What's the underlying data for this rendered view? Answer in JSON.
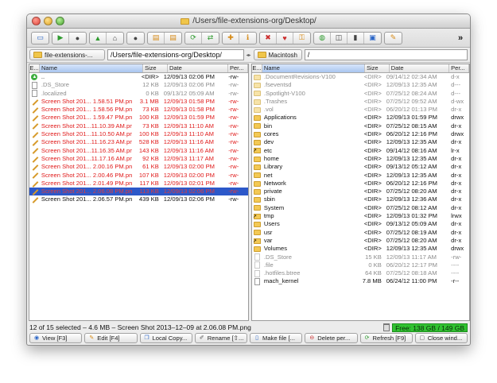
{
  "window": {
    "title": "/Users/file-extensions-org/Desktop/"
  },
  "toolbar": {
    "more_label": "»",
    "buttons": [
      [
        "monitor-icon"
      ],
      [
        "play-icon",
        "stop-icon"
      ],
      [
        "up-icon",
        "home-icon"
      ],
      [
        "record-icon"
      ],
      [
        "copy-folder-icon",
        "move-folder-icon"
      ],
      [
        "refresh-icon",
        "swap-icon"
      ],
      [
        "new-folder-icon",
        "folder-info-icon"
      ],
      [
        "delete-icon",
        "favorite-icon",
        "key-icon"
      ],
      [
        "globe-icon",
        "split-icon",
        "terminal-icon",
        "screen-icon"
      ],
      [
        "wand-icon"
      ]
    ]
  },
  "left_pane": {
    "drive_label": "file-extensions-...",
    "path": "/Users/file-extensions-org/Desktop/",
    "headers": {
      "ext": "E...",
      "name": "Name",
      "size": "Size",
      "date": "Date",
      "perm": "Per..."
    },
    "rows": [
      {
        "icon": "up",
        "name": "..",
        "size": "<DIR>",
        "date": "12/09/13 02:06 PM",
        "perm": "-rw-",
        "style": "normal"
      },
      {
        "icon": "file",
        "name": ".DS_Store",
        "size": "12 KB",
        "date": "12/09/13 02:06 PM",
        "perm": "-rw-",
        "style": "dim"
      },
      {
        "icon": "file",
        "name": ".localized",
        "size": "0 KB",
        "date": "09/13/12 05:09 AM",
        "perm": "-rw-",
        "style": "dim"
      },
      {
        "icon": "pen",
        "name": "Screen Shot 201... 1.58.51 PM.png",
        "size": "3.1 MB",
        "date": "12/09/13 01:58 PM",
        "perm": "-rw-",
        "style": "red"
      },
      {
        "icon": "pen",
        "name": "Screen Shot 201... 1.58.56 PM.png",
        "size": "73 KB",
        "date": "12/09/13 01:58 PM",
        "perm": "-rw-",
        "style": "red"
      },
      {
        "icon": "pen",
        "name": "Screen Shot 201... 1.59.47 PM.png",
        "size": "100 KB",
        "date": "12/09/13 01:59 PM",
        "perm": "-rw-",
        "style": "red"
      },
      {
        "icon": "pen",
        "name": "Screen Shot 201...11.10.39 AM.png",
        "size": "73 KB",
        "date": "12/09/13 11:10 AM",
        "perm": "-rw-",
        "style": "red"
      },
      {
        "icon": "pen",
        "name": "Screen Shot 201...11.10.50 AM.png",
        "size": "100 KB",
        "date": "12/09/13 11:10 AM",
        "perm": "-rw-",
        "style": "red"
      },
      {
        "icon": "pen",
        "name": "Screen Shot 201...11.16.23 AM.png",
        "size": "528 KB",
        "date": "12/09/13 11:16 AM",
        "perm": "-rw-",
        "style": "red"
      },
      {
        "icon": "pen",
        "name": "Screen Shot 201...11.16.35 AM.png",
        "size": "143 KB",
        "date": "12/09/13 11:16 AM",
        "perm": "-rw-",
        "style": "red"
      },
      {
        "icon": "pen",
        "name": "Screen Shot 201...11.17.16 AM.png",
        "size": "92 KB",
        "date": "12/09/13 11:17 AM",
        "perm": "-rw-",
        "style": "red"
      },
      {
        "icon": "pen",
        "name": "Screen Shot 201... 2.00.16 PM.png",
        "size": "61 KB",
        "date": "12/09/13 02:00 PM",
        "perm": "-rw-",
        "style": "red"
      },
      {
        "icon": "pen",
        "name": "Screen Shot 201... 2.00.46 PM.png",
        "size": "107 KB",
        "date": "12/09/13 02:00 PM",
        "perm": "-rw-",
        "style": "red"
      },
      {
        "icon": "pen",
        "name": "Screen Shot 201... 2.01.49 PM.png",
        "size": "117 KB",
        "date": "12/09/13 02:01 PM",
        "perm": "-rw-",
        "style": "red"
      },
      {
        "icon": "pen",
        "name": "Screen Shot 201... 2.06.08 PM.png",
        "size": "113 KB",
        "date": "12/09/13 02:06 PM",
        "perm": "-rw-",
        "style": "sel"
      },
      {
        "icon": "pen",
        "name": "Screen Shot 201... 2.06.57 PM.png",
        "size": "439 KB",
        "date": "12/09/13 02:06 PM",
        "perm": "-rw-",
        "style": "normal"
      }
    ]
  },
  "right_pane": {
    "drive_label": "Macintosh",
    "path": "/",
    "headers": {
      "ext": "E...",
      "name": "Name",
      "size": "Size",
      "date": "Date",
      "perm": "Per..."
    },
    "rows": [
      {
        "icon": "folder-dim",
        "name": ".DocumentRevisions-V100",
        "size": "<DIR>",
        "date": "09/14/12 02:34 AM",
        "perm": "d-x",
        "style": "dim"
      },
      {
        "icon": "folder-dim",
        "name": ".fseventsd",
        "size": "<DIR>",
        "date": "12/09/13 12:35 AM",
        "perm": "d---",
        "style": "dim"
      },
      {
        "icon": "folder-dim",
        "name": ".Spotlight-V100",
        "size": "<DIR>",
        "date": "07/25/12 08:24 AM",
        "perm": "d---",
        "style": "dim"
      },
      {
        "icon": "folder-dim",
        "name": ".Trashes",
        "size": "<DIR>",
        "date": "07/25/12 09:52 AM",
        "perm": "d-wx",
        "style": "dim"
      },
      {
        "icon": "folder-dim",
        "name": ".vol",
        "size": "<DIR>",
        "date": "06/20/12 01:13 PM",
        "perm": "dr-x",
        "style": "dim"
      },
      {
        "icon": "folder",
        "name": "Applications",
        "size": "<DIR>",
        "date": "12/09/13 01:59 PM",
        "perm": "drwx",
        "style": "normal"
      },
      {
        "icon": "folder",
        "name": "bin",
        "size": "<DIR>",
        "date": "07/25/12 08:15 AM",
        "perm": "dr-x",
        "style": "normal"
      },
      {
        "icon": "folder",
        "name": "cores",
        "size": "<DIR>",
        "date": "06/20/12 12:16 PM",
        "perm": "drwx",
        "style": "normal"
      },
      {
        "icon": "folder",
        "name": "dev",
        "size": "<DIR>",
        "date": "12/09/13 12:35 AM",
        "perm": "dr-x",
        "style": "normal"
      },
      {
        "icon": "link",
        "name": "etc",
        "size": "<DIR>",
        "date": "09/14/12 08:16 AM",
        "perm": "lr-x",
        "style": "normal"
      },
      {
        "icon": "folder",
        "name": "home",
        "size": "<DIR>",
        "date": "12/09/13 12:35 AM",
        "perm": "dr-x",
        "style": "normal"
      },
      {
        "icon": "folder",
        "name": "Library",
        "size": "<DIR>",
        "date": "09/13/12 05:12 AM",
        "perm": "dr-x",
        "style": "normal"
      },
      {
        "icon": "folder",
        "name": "net",
        "size": "<DIR>",
        "date": "12/09/13 12:35 AM",
        "perm": "dr-x",
        "style": "normal"
      },
      {
        "icon": "folder",
        "name": "Network",
        "size": "<DIR>",
        "date": "06/20/12 12:16 PM",
        "perm": "dr-x",
        "style": "normal"
      },
      {
        "icon": "folder",
        "name": "private",
        "size": "<DIR>",
        "date": "07/25/12 08:20 AM",
        "perm": "dr-x",
        "style": "normal"
      },
      {
        "icon": "folder",
        "name": "sbin",
        "size": "<DIR>",
        "date": "12/09/13 12:36 AM",
        "perm": "dr-x",
        "style": "normal"
      },
      {
        "icon": "folder",
        "name": "System",
        "size": "<DIR>",
        "date": "07/25/12 08:12 AM",
        "perm": "dr-x",
        "style": "normal"
      },
      {
        "icon": "link",
        "name": "tmp",
        "size": "<DIR>",
        "date": "12/09/13 01:32 PM",
        "perm": "lrwx",
        "style": "normal"
      },
      {
        "icon": "folder",
        "name": "Users",
        "size": "<DIR>",
        "date": "09/13/12 05:09 AM",
        "perm": "dr-x",
        "style": "normal"
      },
      {
        "icon": "folder",
        "name": "usr",
        "size": "<DIR>",
        "date": "07/25/12 08:19 AM",
        "perm": "dr-x",
        "style": "normal"
      },
      {
        "icon": "link",
        "name": "var",
        "size": "<DIR>",
        "date": "07/25/12 08:20 AM",
        "perm": "dr-x",
        "style": "normal"
      },
      {
        "icon": "folder",
        "name": "Volumes",
        "size": "<DIR>",
        "date": "12/09/13 12:35 AM",
        "perm": "drwx",
        "style": "normal"
      },
      {
        "icon": "file-dim",
        "name": ".DS_Store",
        "size": "15 KB",
        "date": "12/09/13 11:17 AM",
        "perm": "-rw-",
        "style": "dim"
      },
      {
        "icon": "file-dim",
        "name": ".file",
        "size": "0 KB",
        "date": "06/20/12 12:17 PM",
        "perm": "----",
        "style": "dim"
      },
      {
        "icon": "file-dim",
        "name": ".hotfiles.btree",
        "size": "64 KB",
        "date": "07/25/12 08:18 AM",
        "perm": "----",
        "style": "dim"
      },
      {
        "icon": "file",
        "name": "mach_kernel",
        "size": "7.8 MB",
        "date": "06/24/12 11:00 PM",
        "perm": "-r--",
        "style": "normal"
      }
    ]
  },
  "status": {
    "selection": "12 of 15 selected – 4.6 MB – Screen Shot 2013–12–09 at 2.06.08 PM.png",
    "free": "Free: 138 GB / 149 GB",
    "free_color": "#31c231"
  },
  "fkeys": [
    {
      "name": "view-button",
      "icon": "eye-icon",
      "label": "View [F3]"
    },
    {
      "name": "edit-button",
      "icon": "pencil-icon",
      "label": "Edit [F4]"
    },
    {
      "name": "local-copy-button",
      "icon": "copy-icon",
      "label": "Local Copy..."
    },
    {
      "name": "rename-button",
      "icon": "rename-icon",
      "label": "Rename [⇧..."
    },
    {
      "name": "make-file-button",
      "icon": "new-file-icon",
      "label": "Make file [..."
    },
    {
      "name": "delete-button",
      "icon": "delete-icon",
      "label": "Delete per..."
    },
    {
      "name": "refresh-button",
      "icon": "refresh-icon",
      "label": "Refresh [F9]"
    },
    {
      "name": "close-window-button",
      "icon": "close-window-icon",
      "label": "Close wind..."
    }
  ],
  "colors": {
    "selected_row": "#2c58c9",
    "marked_text": "#e01a1a",
    "dim_text": "#8c8c8c"
  }
}
